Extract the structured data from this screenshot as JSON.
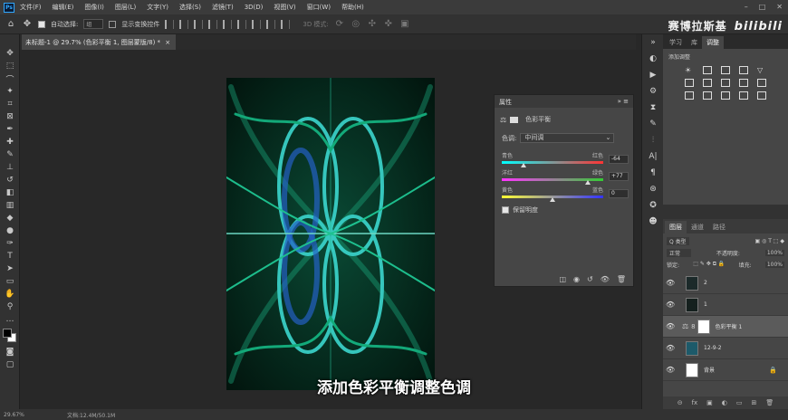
{
  "app": {
    "logo": "Ps"
  },
  "menu": [
    "文件(F)",
    "编辑(E)",
    "图像(I)",
    "图层(L)",
    "文字(Y)",
    "选择(S)",
    "滤镜(T)",
    "3D(D)",
    "视图(V)",
    "窗口(W)",
    "帮助(H)"
  ],
  "options": {
    "auto_select": "自动选择:",
    "auto_select_value": "组",
    "show_transform": "显示变换控件",
    "mode_3d": "3D 模式:"
  },
  "brand": {
    "text": "赛博拉斯基",
    "bili": "bilibili"
  },
  "document": {
    "tab_title": "未标题-1 @ 29.7% (色彩平衡 1, 图层蒙版/8) *"
  },
  "properties": {
    "panel_title": "属性",
    "type_label": "色彩平衡",
    "tone_label": "色调:",
    "tone_value": "中间调",
    "sliders": [
      {
        "left": "青色",
        "right": "红色",
        "value": "-64",
        "fraction": 0.21
      },
      {
        "left": "洋红",
        "right": "绿色",
        "value": "+77",
        "fraction": 0.85
      },
      {
        "left": "黄色",
        "right": "蓝色",
        "value": "0",
        "fraction": 0.5
      }
    ],
    "preserve_luminosity": "保留明度"
  },
  "right_tabs": {
    "learn": "学习",
    "library": "库",
    "adjust": "调整"
  },
  "adjust_title": "添加调整",
  "layers_tabs": {
    "layers": "图层",
    "channels": "通道",
    "paths": "路径"
  },
  "layers_controls": {
    "kind": "Q 类型",
    "blend": "正常",
    "opacity_label": "不透明度:",
    "opacity": "100%",
    "lock_label": "锁定:",
    "fill_label": "填充:",
    "fill": "100%"
  },
  "layers": [
    {
      "name": "2",
      "selected": false
    },
    {
      "name": "1",
      "selected": false
    },
    {
      "name": "色彩平衡 1",
      "selected": true
    },
    {
      "name": "12-9-2",
      "selected": false
    },
    {
      "name": "背景",
      "selected": false
    }
  ],
  "status": {
    "zoom": "29.67%",
    "doc": "文档:12.4M/50.1M"
  },
  "subtitle": "添加色彩平衡调整色调",
  "colors": {
    "art_green": "#16c08a",
    "art_cyan": "#3fe0d8",
    "art_blue": "#2a68e0"
  }
}
